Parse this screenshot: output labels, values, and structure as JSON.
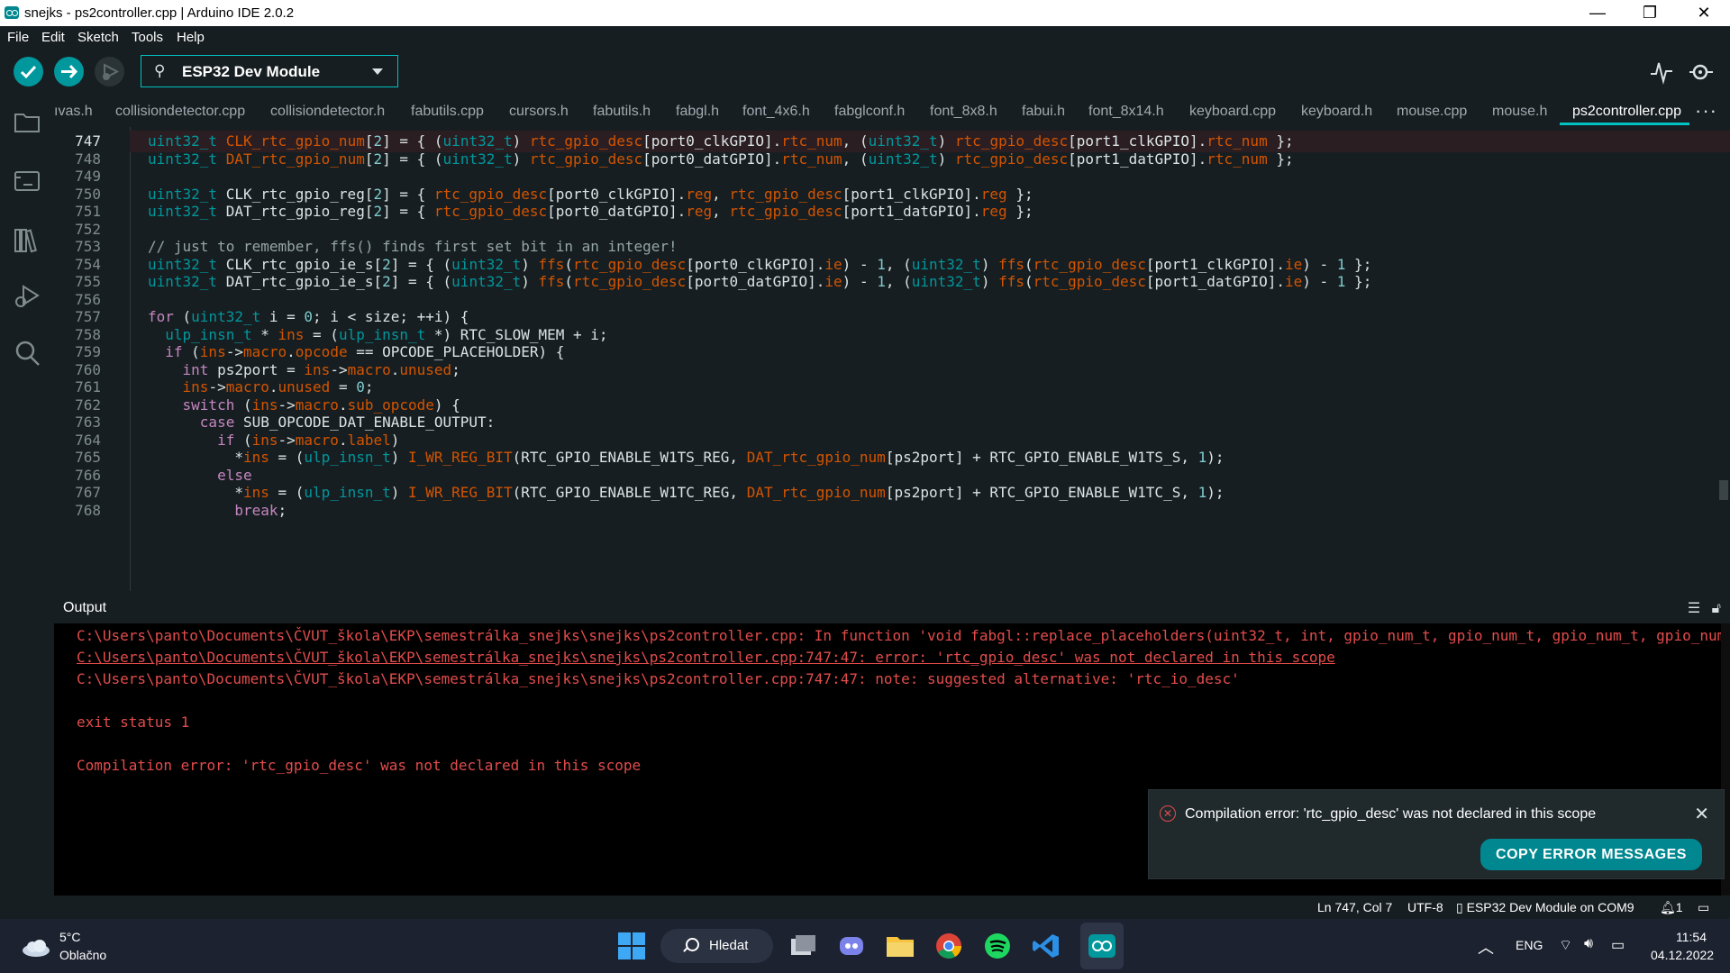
{
  "window": {
    "title": "snejks - ps2controller.cpp | Arduino IDE 2.0.2",
    "minimize": "—",
    "maximize": "❐",
    "close": "✕"
  },
  "menu": [
    "File",
    "Edit",
    "Sketch",
    "Tools",
    "Help"
  ],
  "toolbar": {
    "board": "ESP32 Dev Module"
  },
  "tabs": [
    "ıvas.h",
    "collisiondetector.cpp",
    "collisiondetector.h",
    "fabutils.cpp",
    "cursors.h",
    "fabutils.h",
    "fabgl.h",
    "font_4x6.h",
    "fabglconf.h",
    "font_8x8.h",
    "fabui.h",
    "font_8x14.h",
    "keyboard.cpp",
    "keyboard.h",
    "mouse.cpp",
    "mouse.h",
    "ps2controller.cpp"
  ],
  "tabs_more": "···",
  "editor": {
    "lines": [
      {
        "n": "747",
        "text": "uint32_t CLK_rtc_gpio_num[2] = { (uint32_t) rtc_gpio_desc[port0_clkGPIO].rtc_num, (uint32_t) rtc_gpio_desc[port1_clkGPIO].rtc_num };"
      },
      {
        "n": "748",
        "text": "uint32_t DAT_rtc_gpio_num[2] = { (uint32_t) rtc_gpio_desc[port0_datGPIO].rtc_num, (uint32_t) rtc_gpio_desc[port1_datGPIO].rtc_num };"
      },
      {
        "n": "749",
        "text": ""
      },
      {
        "n": "750",
        "text": "uint32_t CLK_rtc_gpio_reg[2] = { rtc_gpio_desc[port0_clkGPIO].reg, rtc_gpio_desc[port1_clkGPIO].reg };"
      },
      {
        "n": "751",
        "text": "uint32_t DAT_rtc_gpio_reg[2] = { rtc_gpio_desc[port0_datGPIO].reg, rtc_gpio_desc[port1_datGPIO].reg };"
      },
      {
        "n": "752",
        "text": ""
      },
      {
        "n": "753",
        "text": "// just to remember, ffs() finds first set bit in an integer!"
      },
      {
        "n": "754",
        "text": "uint32_t CLK_rtc_gpio_ie_s[2] = { (uint32_t) ffs(rtc_gpio_desc[port0_clkGPIO].ie) - 1, (uint32_t) ffs(rtc_gpio_desc[port1_clkGPIO].ie) - 1 };"
      },
      {
        "n": "755",
        "text": "uint32_t DAT_rtc_gpio_ie_s[2] = { (uint32_t) ffs(rtc_gpio_desc[port0_datGPIO].ie) - 1, (uint32_t) ffs(rtc_gpio_desc[port1_datGPIO].ie) - 1 };"
      },
      {
        "n": "756",
        "text": ""
      },
      {
        "n": "757",
        "text": "for (uint32_t i = 0; i < size; ++i) {"
      },
      {
        "n": "758",
        "text": "  ulp_insn_t * ins = (ulp_insn_t *) RTC_SLOW_MEM + i;"
      },
      {
        "n": "759",
        "text": "  if (ins->macro.opcode == OPCODE_PLACEHOLDER) {"
      },
      {
        "n": "760",
        "text": "    int ps2port = ins->macro.unused;"
      },
      {
        "n": "761",
        "text": "    ins->macro.unused = 0;"
      },
      {
        "n": "762",
        "text": "    switch (ins->macro.sub_opcode) {"
      },
      {
        "n": "763",
        "text": "      case SUB_OPCODE_DAT_ENABLE_OUTPUT:"
      },
      {
        "n": "764",
        "text": "        if (ins->macro.label)"
      },
      {
        "n": "765",
        "text": "          *ins = (ulp_insn_t) I_WR_REG_BIT(RTC_GPIO_ENABLE_W1TS_REG, DAT_rtc_gpio_num[ps2port] + RTC_GPIO_ENABLE_W1TS_S, 1);"
      },
      {
        "n": "766",
        "text": "        else"
      },
      {
        "n": "767",
        "text": "          *ins = (ulp_insn_t) I_WR_REG_BIT(RTC_GPIO_ENABLE_W1TC_REG, DAT_rtc_gpio_num[ps2port] + RTC_GPIO_ENABLE_W1TC_S, 1);"
      },
      {
        "n": "768",
        "text": "          break;"
      }
    ]
  },
  "output": {
    "title": "Output",
    "lines": [
      "C:\\Users\\panto\\Documents\\ČVUT_škola\\EKP\\semestrálka_snejks\\snejks\\ps2controller.cpp: In function 'void fabgl::replace_placeholders(uint32_t, int, gpio_num_t, gpio_num_t, gpio_num_t, gpio_num",
      "C:\\Users\\panto\\Documents\\ČVUT_škola\\EKP\\semestrálka_snejks\\snejks\\ps2controller.cpp:747:47: error: 'rtc_gpio_desc' was not declared in this scope",
      "C:\\Users\\panto\\Documents\\ČVUT_škola\\EKP\\semestrálka_snejks\\snejks\\ps2controller.cpp:747:47: note: suggested alternative: 'rtc_io_desc'",
      "",
      "exit status 1",
      "",
      "Compilation error: 'rtc_gpio_desc' was not declared in this scope"
    ]
  },
  "toast": {
    "message": "Compilation error: 'rtc_gpio_desc' was not declared in this scope",
    "button": "COPY ERROR MESSAGES"
  },
  "status": {
    "position": "Ln 747, Col 7",
    "encoding": "UTF-8",
    "board_port": "ESP32 Dev Module on COM9",
    "notifications": "1"
  },
  "taskbar": {
    "weather_temp": "5°C",
    "weather_desc": "Oblačno",
    "search": "Hledat",
    "language": "ENG",
    "time": "11:54",
    "date": "04.12.2022"
  },
  "colors": {
    "accent": "#00979d",
    "error": "#e34c4c",
    "background": "#171e21"
  }
}
